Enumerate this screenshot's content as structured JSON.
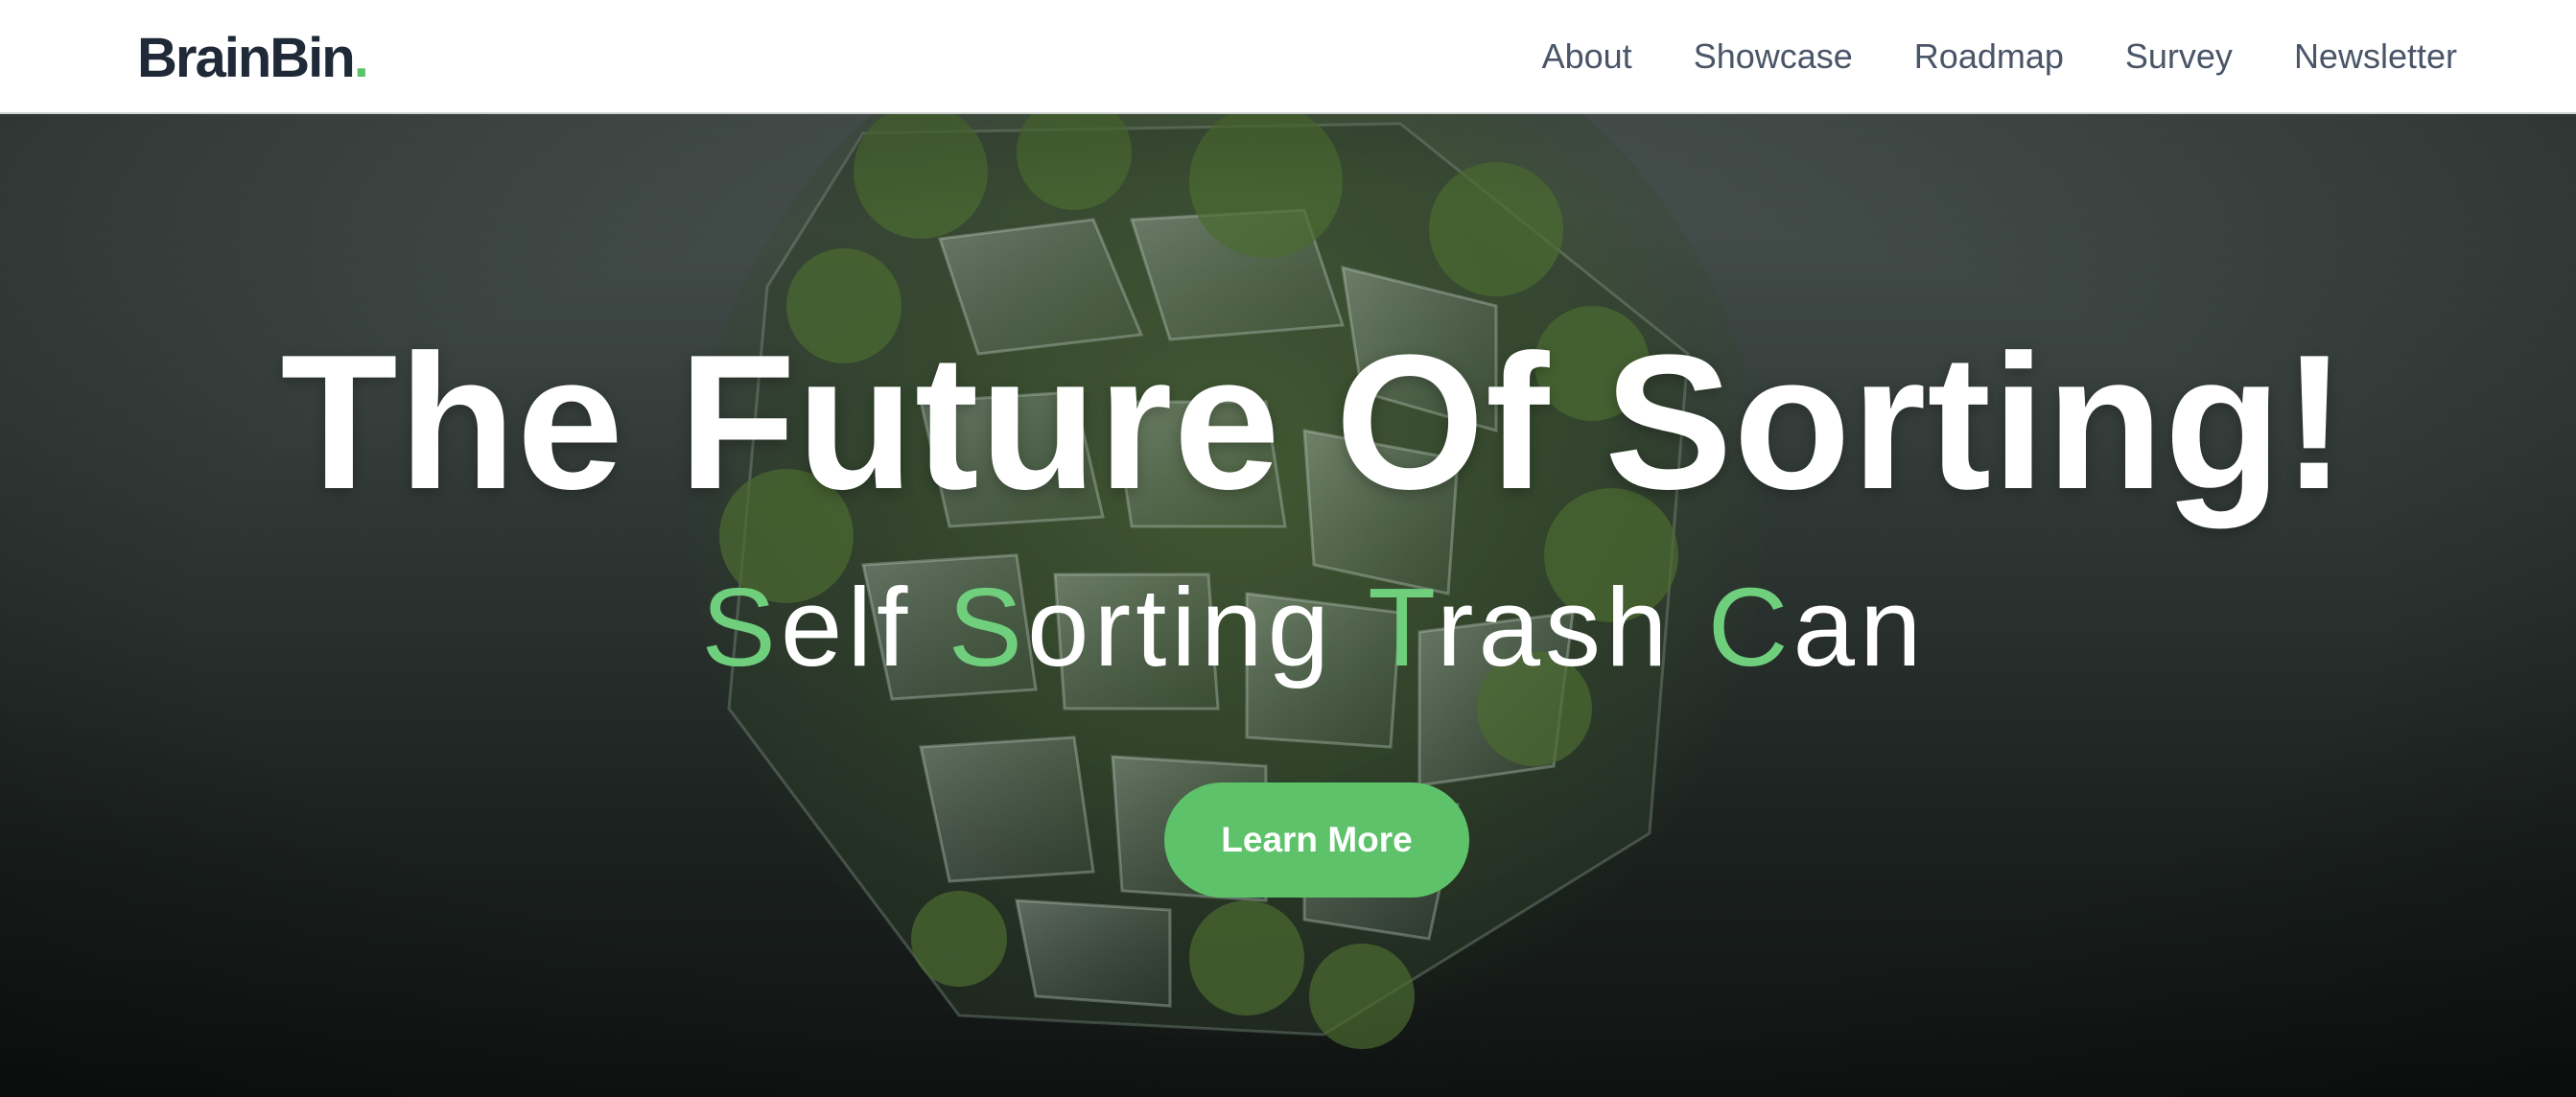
{
  "brand": {
    "name": "BrainBin",
    "dot": ".",
    "accent_color": "#5ec26a",
    "text_color": "#1f2937"
  },
  "nav": {
    "items": [
      {
        "label": "About"
      },
      {
        "label": "Showcase"
      },
      {
        "label": "Roadmap"
      },
      {
        "label": "Survey"
      },
      {
        "label": "Newsletter"
      }
    ],
    "text_color": "#4a5568"
  },
  "hero": {
    "title": "The Future Of Sorting!",
    "subtitle": {
      "words": [
        {
          "accent": "S",
          "rest": "elf"
        },
        {
          "accent": "S",
          "rest": "orting"
        },
        {
          "accent": "T",
          "rest": "rash"
        },
        {
          "accent": "C",
          "rest": "an"
        }
      ],
      "accent_color": "#6fcf7c"
    },
    "cta_label": "Learn More",
    "background_image": "green-glass-cube-with-plants"
  }
}
